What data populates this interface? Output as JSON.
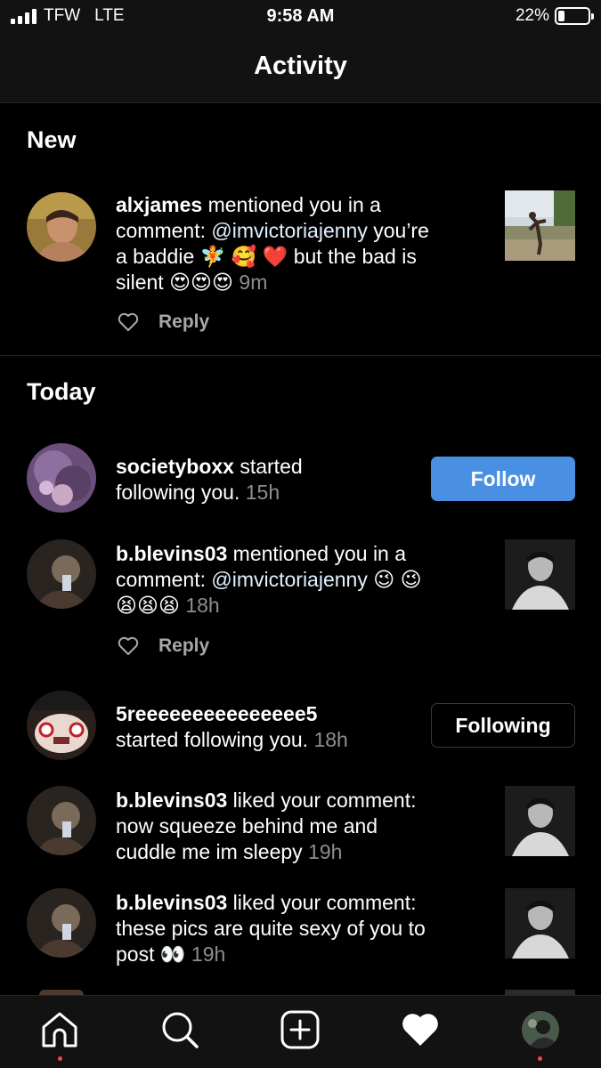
{
  "status_bar": {
    "carrier": "TFW",
    "network": "LTE",
    "time": "9:58 AM",
    "battery": "22%",
    "battery_level": 0.22
  },
  "header": {
    "title": "Activity"
  },
  "sections": {
    "new": "New",
    "today": "Today"
  },
  "items": [
    {
      "user": "alxjames",
      "line1": " mentioned you in a",
      "line2_pre": "comment: ",
      "mention": "@imvictoriajenny",
      "line2_post": " you’re",
      "line3": "a baddie 🧚 🥰 ❤️  but the bad is",
      "line4": "silent 😍😍😍 ",
      "time": "9m",
      "reply": "Reply"
    },
    {
      "user": "societyboxx",
      "line1": " started",
      "line2": "following you. ",
      "time": "15h",
      "button": "Follow"
    },
    {
      "user": "b.blevins03",
      "line1": " mentioned you in a",
      "line2_pre": "comment: ",
      "mention": "@imvictoriajenny",
      "line2_post": " 😉 😉",
      "line3": "😫😫😫 ",
      "time": "18h",
      "reply": "Reply"
    },
    {
      "user": "5reeeeeeeeeeeeeee5",
      "line2": "started following you. ",
      "time": "18h",
      "button": "Following"
    },
    {
      "user": "b.blevins03",
      "line1": " liked your comment:",
      "line2": "now squeeze behind me and",
      "line3": "cuddle me im sleepy ",
      "time": "19h"
    },
    {
      "user": "b.blevins03",
      "line1": " liked your comment:",
      "line2": "these pics are quite sexy of you to",
      "line3": "post 👀 ",
      "time": "19h"
    }
  ],
  "tab_bar": {
    "icons": [
      "home-icon",
      "search-icon",
      "new-post-icon",
      "heart-icon",
      "profile-avatar"
    ]
  }
}
